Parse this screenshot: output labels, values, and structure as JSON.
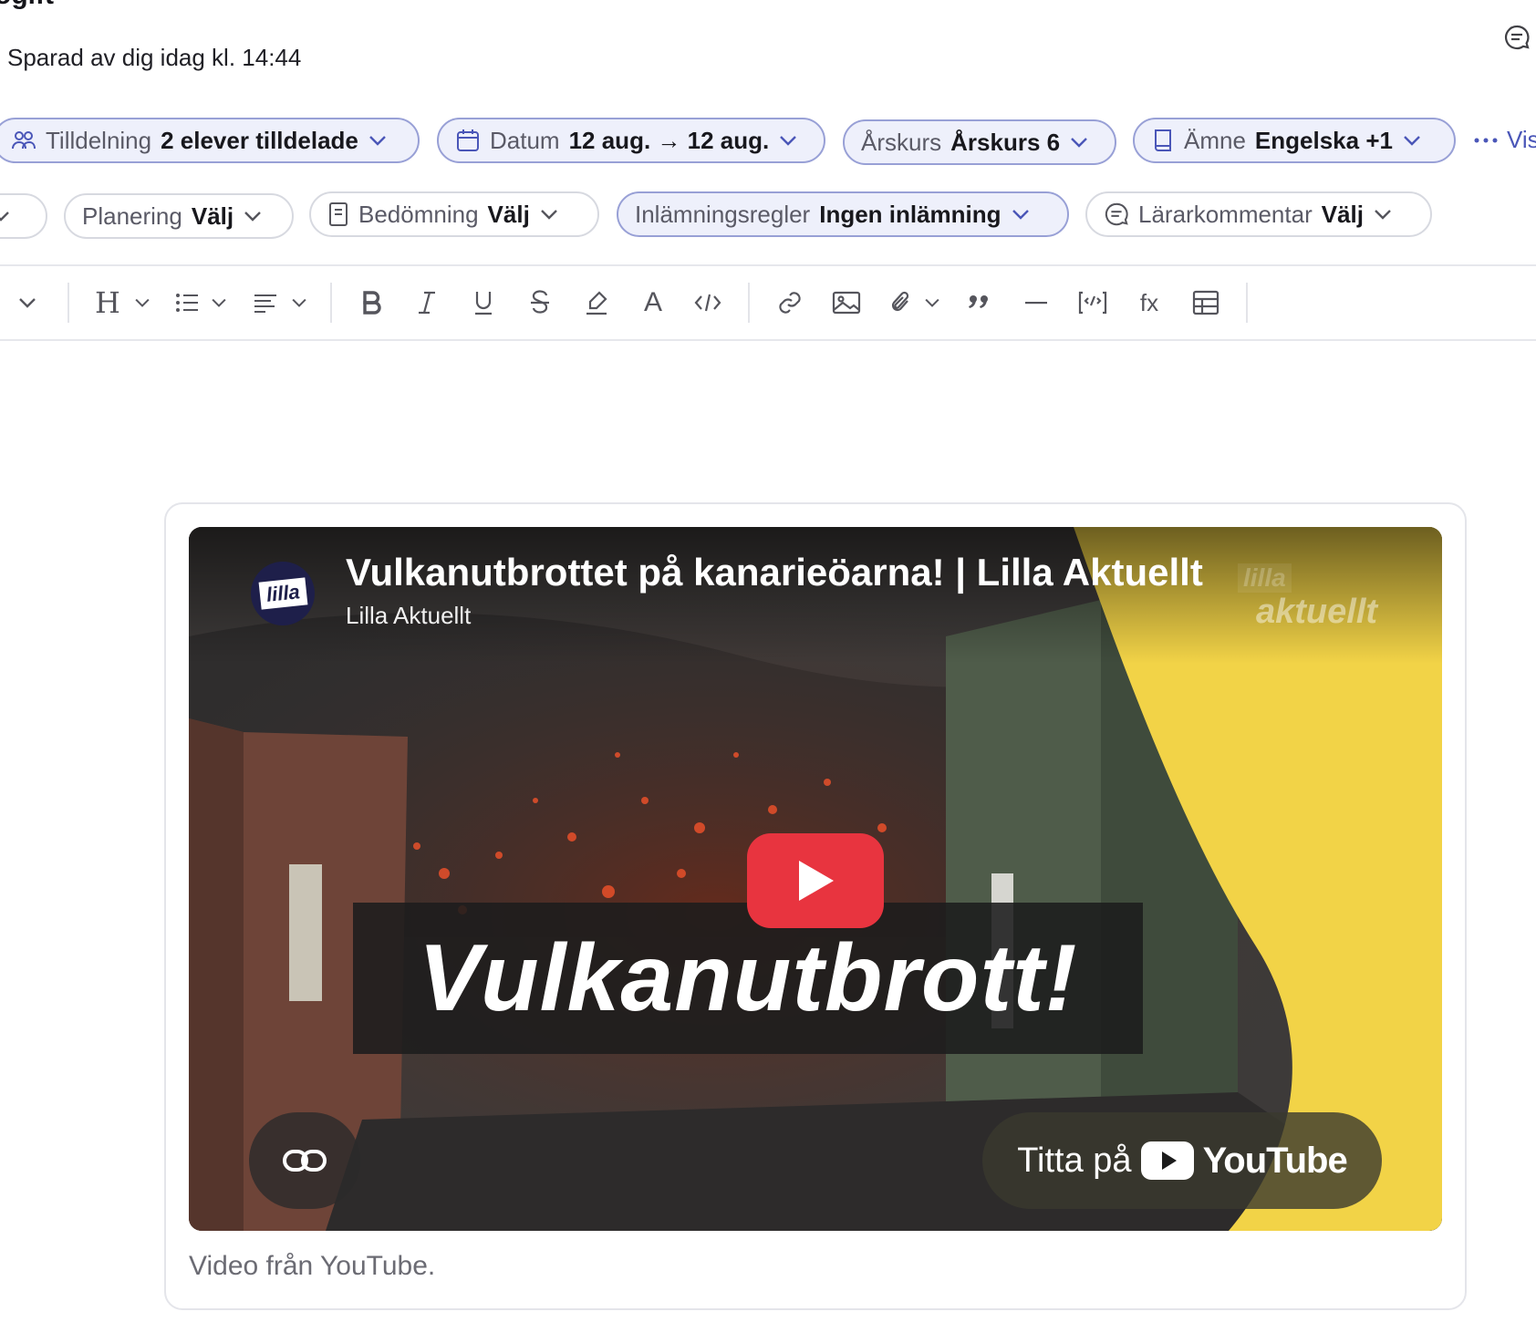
{
  "header": {
    "title": "ogift",
    "saved_status": "Sparad av dig idag kl. 14:44"
  },
  "chips_row1": [
    {
      "label": "Tilldelning",
      "value": "2 elever tilldelade"
    },
    {
      "label": "Datum",
      "value": "12 aug. → 12 aug."
    },
    {
      "label": "Årskurs",
      "value": "Årskurs 6"
    },
    {
      "label": "Ämne",
      "value": "Engelska +1"
    }
  ],
  "more_label": "Vis",
  "chips_row2": [
    {
      "label": "Planering",
      "value": "Välj"
    },
    {
      "label": "Bedömning",
      "value": "Välj"
    },
    {
      "label": "Inlämningsregler",
      "value": "Ingen inlämning"
    },
    {
      "label": "Lärarkommentar",
      "value": "Välj"
    }
  ],
  "toolbar": {
    "heading_glyph": "H",
    "text_color_glyph": "A",
    "formula_glyph": "fx"
  },
  "video": {
    "title": "Vulkanutbrottet på kanarieöarna! | Lilla Aktuellt",
    "channel": "Lilla Aktuellt",
    "channel_logo_text": "lilla",
    "watermark_line1": "lilla",
    "watermark_line2": "aktuellt",
    "overlay_text": "Vulkanutbrott!",
    "watch_on": "Titta på",
    "youtube_brand": "YouTube",
    "caption": "Video från YouTube."
  },
  "colors": {
    "accent": "#4a56b8",
    "chip_active_bg": "#eef0fb",
    "youtube_red": "#e8343f",
    "brand_yellow": "#f2d347"
  }
}
